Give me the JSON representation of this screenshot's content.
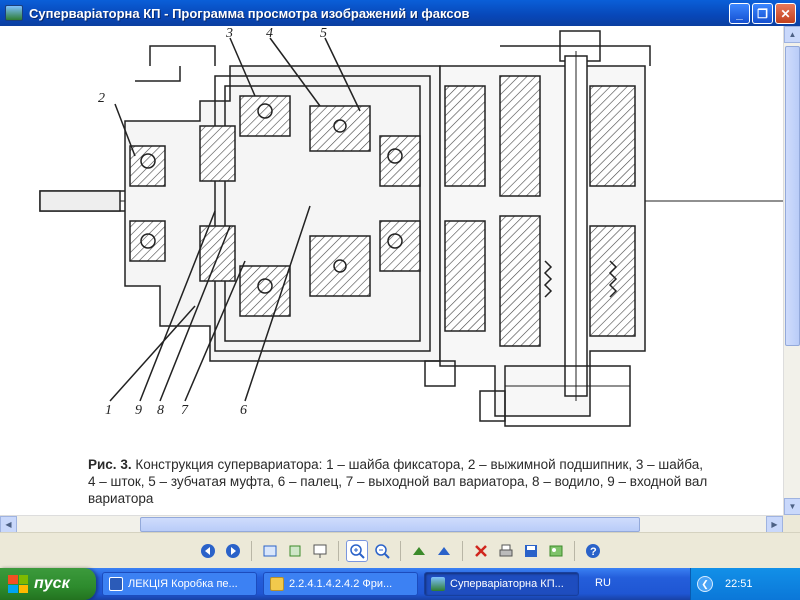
{
  "window": {
    "title": "Суперваріаторна КП - Программа просмотра изображений и факсов",
    "buttons": {
      "minimize": "_",
      "maximize": "❐",
      "close": "✕"
    }
  },
  "figure": {
    "labels": [
      "1",
      "2",
      "3",
      "4",
      "5",
      "6",
      "7",
      "8",
      "9"
    ],
    "caption_prefix": "Рис. 3.",
    "caption_text": "Конструкция супервариатора: 1 – шайба фиксатора, 2 – выжимной подшипник, 3 – шайба, 4 – шток, 5 – зубчатая муфта, 6 – палец, 7 – выходной вал вариатора, 8 – водило, 9 – входной вал вариатора"
  },
  "toolbar": {
    "icons": [
      "prev-image-icon",
      "next-image-icon",
      "best-fit-icon",
      "actual-size-icon",
      "slideshow-icon",
      "zoom-in-icon",
      "zoom-out-icon",
      "rotate-clockwise-icon",
      "rotate-counterclockwise-icon",
      "delete-icon",
      "print-icon",
      "save-icon",
      "edit-icon",
      "help-icon"
    ]
  },
  "taskbar": {
    "start_label": "пуск",
    "tasks": [
      {
        "label": "ЛЕКЦІЯ Коробка пе...",
        "icon": "word-icon",
        "active": false
      },
      {
        "label": "2.2.4.1.4.2.4.2 Фри...",
        "icon": "folder-icon",
        "active": false
      },
      {
        "label": "Суперваріаторна КП...",
        "icon": "image-viewer-icon",
        "active": true
      }
    ],
    "language": "RU",
    "clock": "22:51"
  },
  "colors": {
    "titlebar": "#0a5fd8",
    "taskbar": "#245edb",
    "start": "#2d8b2d",
    "tray": "#0b77d8"
  }
}
